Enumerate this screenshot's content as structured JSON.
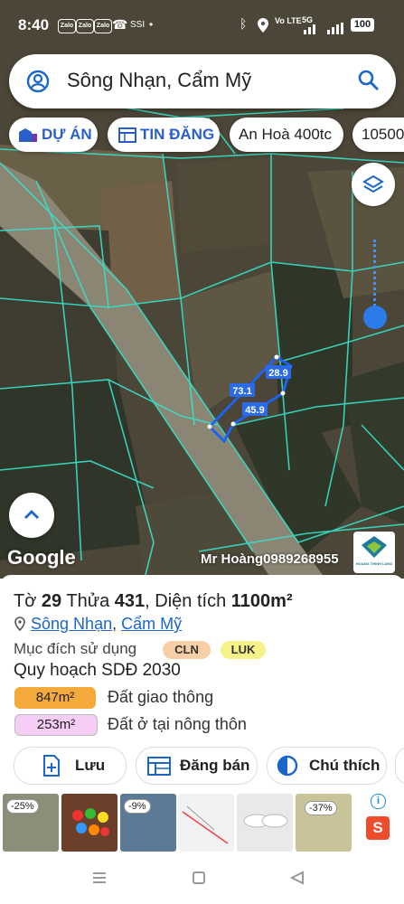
{
  "status_bar": {
    "time": "8:40",
    "zalo_label": "Zalo",
    "network": "Vo LTE",
    "signal": "5G",
    "battery": "100"
  },
  "search": {
    "value": "Sông Nhạn, Cẩm Mỹ"
  },
  "chips": [
    {
      "label": "DỰ ÁN"
    },
    {
      "label": "TIN ĐĂNG"
    },
    {
      "label": "An Hoà 400tc"
    },
    {
      "label": "10500"
    }
  ],
  "map": {
    "parcel_labels": [
      "28.9",
      "73.1",
      "45.9"
    ],
    "provider_logo": "Google",
    "watermark": "Mr Hoàng0989268955",
    "brand_logo_text": "HOANG THINH LAND"
  },
  "parcel": {
    "prefix_sheet": "Tờ",
    "sheet": "29",
    "prefix_plot": "Thửa",
    "plot": "431",
    "prefix_area": ", Diện tích",
    "area": "1100m²",
    "commune": "Sông Nhạn",
    "separator": ",",
    "district": "Cẩm Mỹ",
    "purpose_label": "Mục đích sử dụng",
    "purposes": [
      {
        "code": "CLN",
        "color": "#f7cfa6"
      },
      {
        "code": "LUK",
        "color": "#f5f28a"
      }
    ],
    "plan_label": "Quy hoạch SDĐ 2030",
    "plan_items": [
      {
        "area": "847m²",
        "desc": "Đất giao thông",
        "color": "#f4a93c"
      },
      {
        "area": "253m²",
        "desc": "Đất ở tại nông thôn",
        "color": "#f6cdf4"
      }
    ]
  },
  "actions": [
    {
      "label": "Lưu"
    },
    {
      "label": "Đăng bán"
    },
    {
      "label": "Chú thích"
    }
  ],
  "ads": {
    "items": [
      {
        "discount": "-25%"
      },
      {
        "discount": ""
      },
      {
        "discount": "-9%"
      },
      {
        "discount": ""
      },
      {
        "discount": ""
      },
      {
        "discount": "-37%"
      }
    ],
    "info_icon": "i",
    "shop_icon": "S"
  },
  "colors": {
    "accent": "#2a5fc9",
    "parcel_outline": "#1e63f0",
    "plot_lines": "#37e0c8"
  }
}
